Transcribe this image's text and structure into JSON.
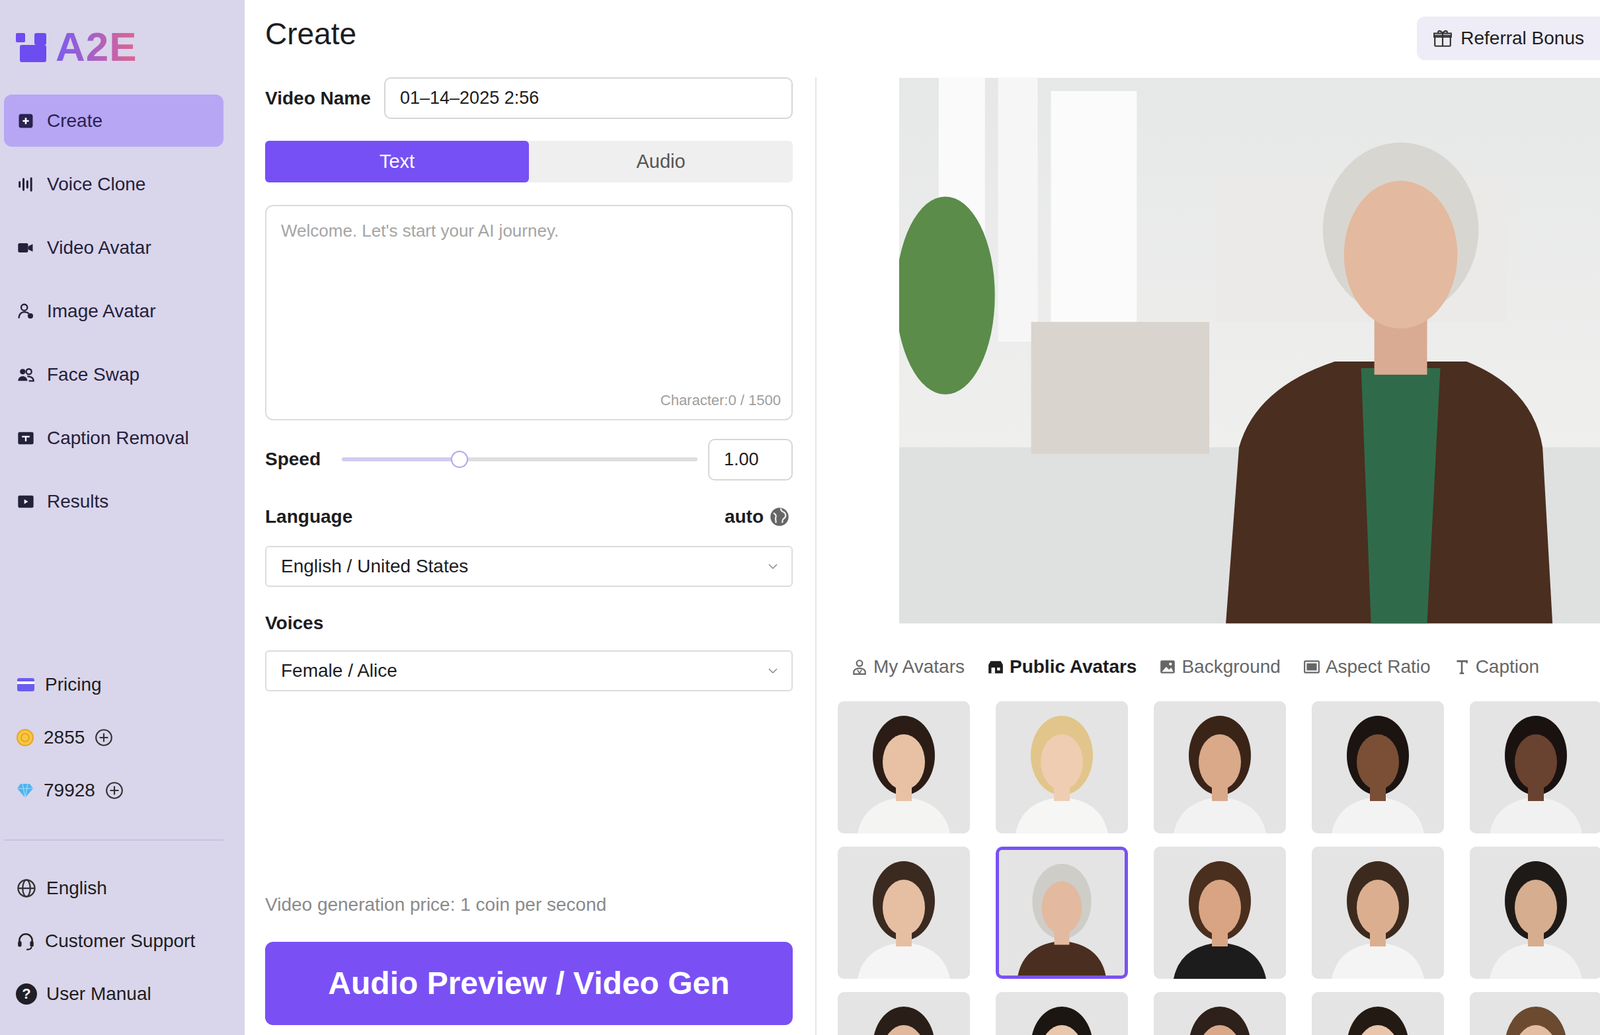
{
  "logo": {
    "text": "A2E"
  },
  "sidebar": {
    "items": [
      {
        "label": "Create",
        "selected": true
      },
      {
        "label": "Voice Clone",
        "selected": false
      },
      {
        "label": "Video Avatar",
        "selected": false
      },
      {
        "label": "Image Avatar",
        "selected": false
      },
      {
        "label": "Face Swap",
        "selected": false
      },
      {
        "label": "Caption Removal",
        "selected": false
      },
      {
        "label": "Results",
        "selected": false
      }
    ],
    "pricing": "Pricing",
    "balances": [
      {
        "kind": "coin",
        "amount": "2855"
      },
      {
        "kind": "diamond",
        "amount": "79928"
      }
    ],
    "footer": [
      {
        "kind": "language",
        "label": "English"
      },
      {
        "kind": "support",
        "label": "Customer Support"
      },
      {
        "kind": "manual",
        "label": "User Manual",
        "badge": "?"
      }
    ]
  },
  "header": {
    "title": "Create",
    "referral": "Referral Bonus"
  },
  "form": {
    "video_name_label": "Video Name",
    "video_name": "01–14–2025 2:56",
    "mode_tabs": [
      {
        "label": "Text",
        "selected": true
      },
      {
        "label": "Audio",
        "selected": false
      }
    ],
    "text_placeholder": "Welcome. Let's start your AI journey.",
    "char_count": "Character:0 / 1500",
    "speed_label": "Speed",
    "speed_level": 0.33,
    "speed_value": "1.00",
    "language_label": "Language",
    "language_auto": "auto",
    "language": "English / United States",
    "voices_label": "Voices",
    "voice": "Female / Alice",
    "price_note": "Video generation price: 1 coin per second",
    "generate_button": "Audio Preview / Video Gen"
  },
  "avatar_tabs": [
    {
      "label": "My Avatars",
      "selected": false
    },
    {
      "label": "Public Avatars",
      "selected": true
    },
    {
      "label": "Background",
      "selected": false
    },
    {
      "label": "Aspect Ratio",
      "selected": false
    },
    {
      "label": "Caption",
      "selected": false
    }
  ],
  "avatars": [
    {
      "selected": false
    },
    {
      "selected": false
    },
    {
      "selected": false
    },
    {
      "selected": false
    },
    {
      "selected": false
    },
    {
      "selected": false
    },
    {
      "selected": true
    },
    {
      "selected": false
    },
    {
      "selected": false
    },
    {
      "selected": false
    },
    {
      "selected": false
    },
    {
      "selected": false
    },
    {
      "selected": false
    },
    {
      "selected": false
    },
    {
      "selected": false
    }
  ]
}
